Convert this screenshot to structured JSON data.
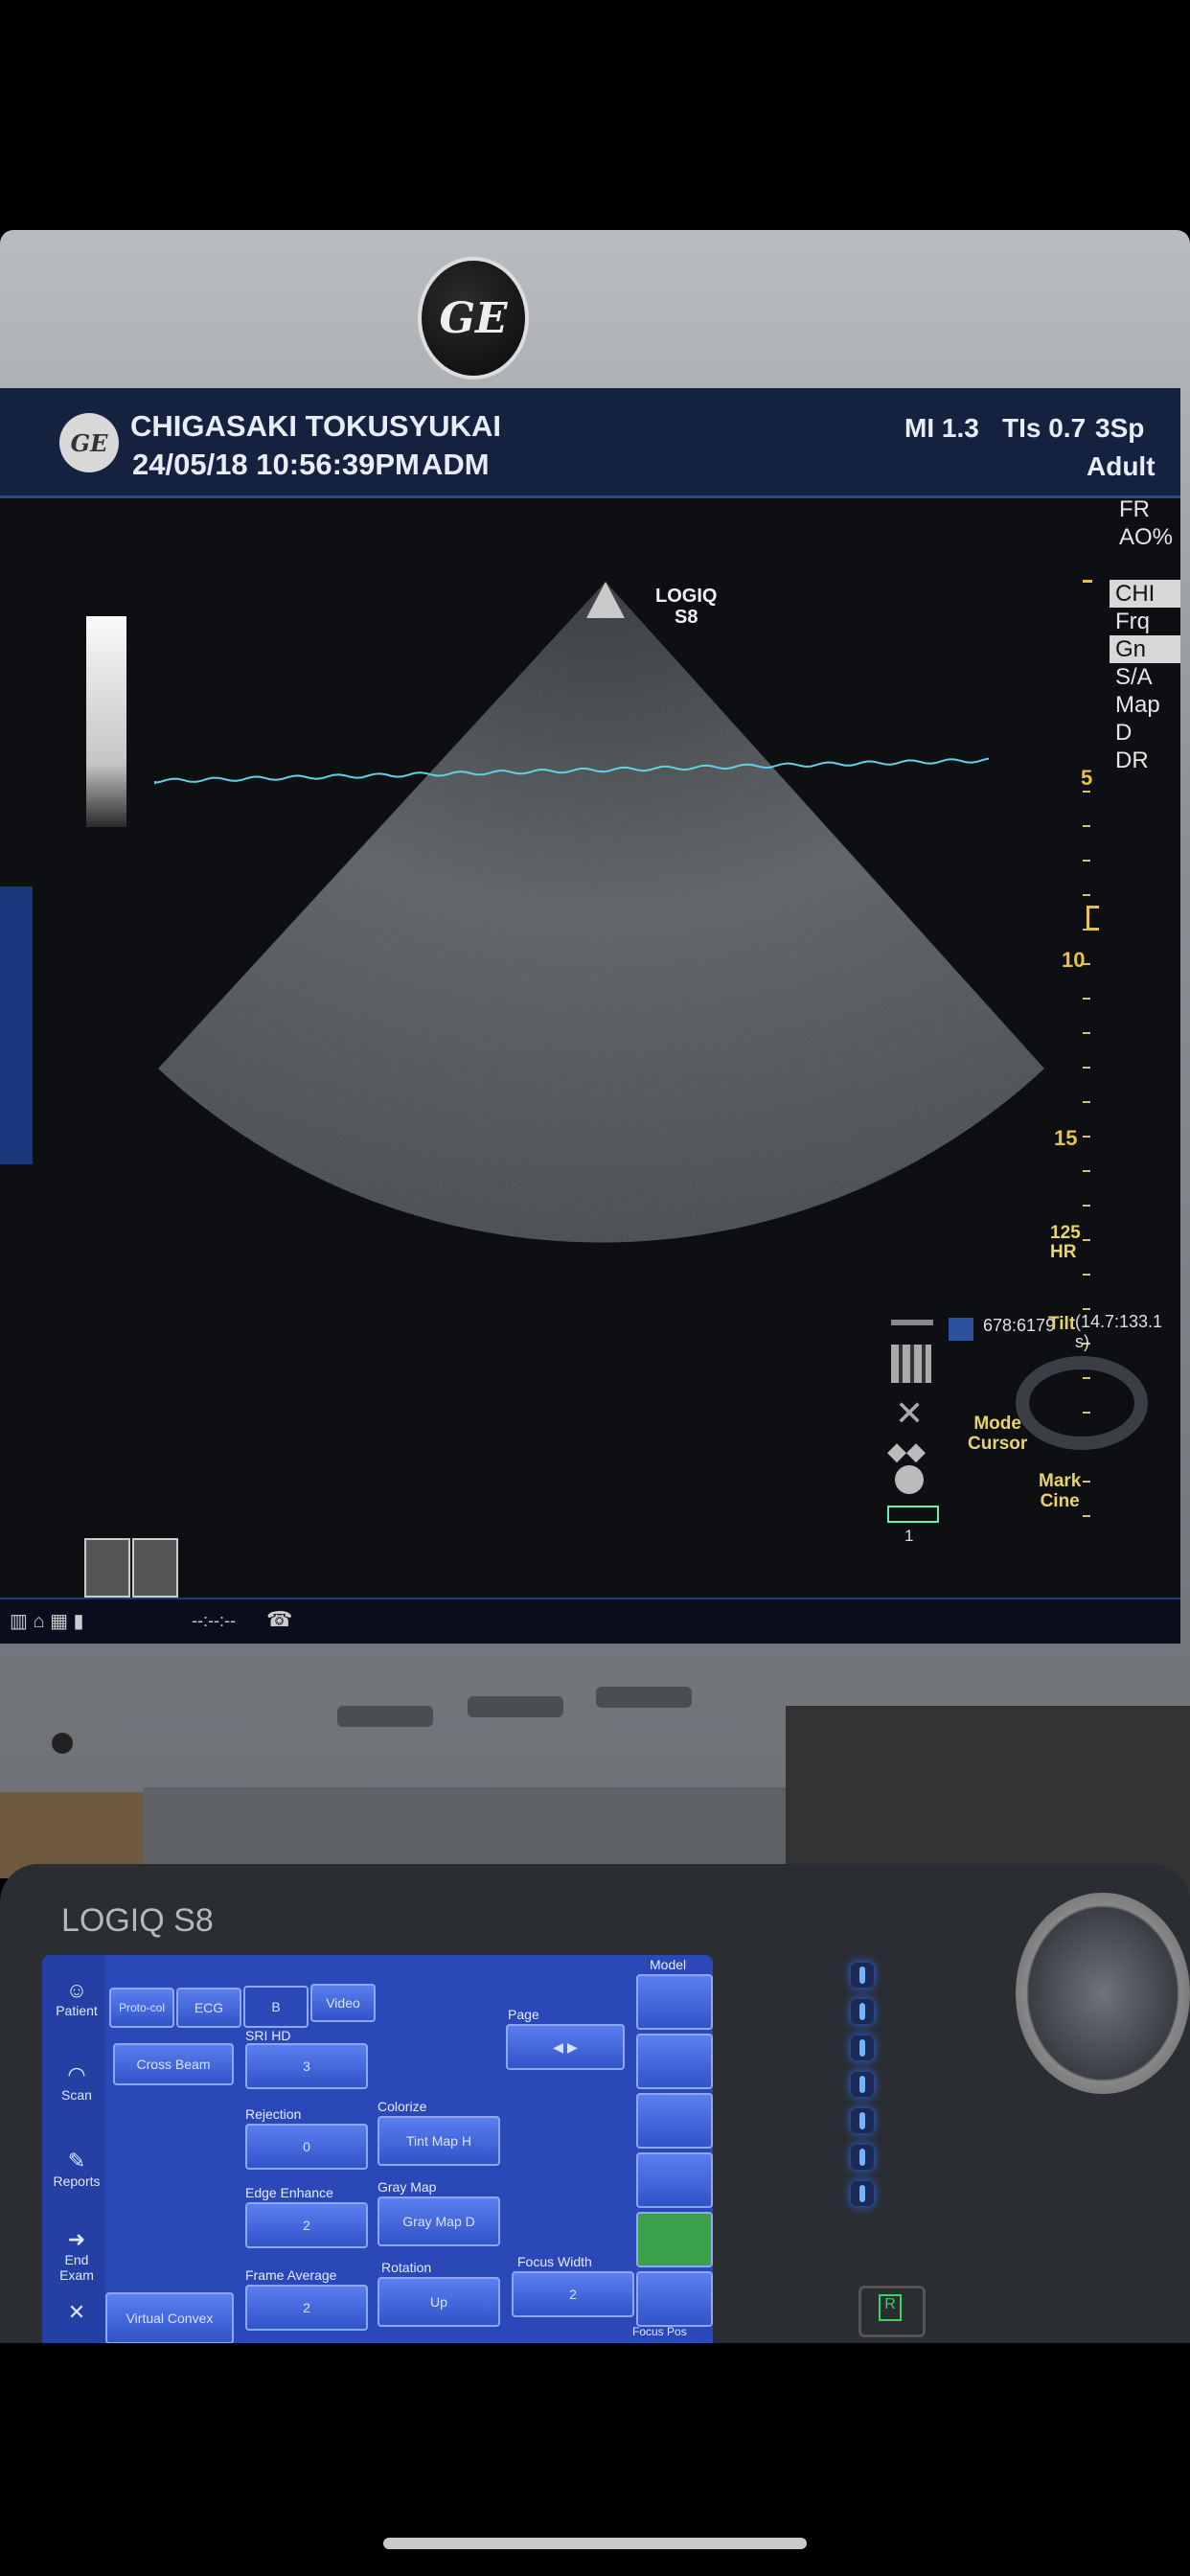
{
  "header": {
    "institution": "CHIGASAKI TOKUSYUKAI",
    "datetime": "24/05/18 10:56:39PM",
    "user": "ADM",
    "mi": "MI 1.3",
    "tis": "TIs 0.7",
    "preset_short": "3Sp",
    "patient_type": "Adult"
  },
  "image_area": {
    "probe_label_line1": "LOGIQ",
    "probe_label_line2": "S8",
    "params": [
      "FR",
      "AO%"
    ],
    "menu": [
      {
        "label": "CHI",
        "highlight": true
      },
      {
        "label": "Frq",
        "highlight": false
      },
      {
        "label": "Gn",
        "highlight": true
      },
      {
        "label": "S/A",
        "highlight": false
      },
      {
        "label": "Map",
        "highlight": false
      },
      {
        "label": "D",
        "highlight": false
      },
      {
        "label": "DR",
        "highlight": false
      }
    ],
    "depth_ticks": [
      "5",
      "10",
      "15"
    ],
    "hr_value": "125",
    "hr_label": "HR",
    "cine_counter": "678:6179",
    "cine_time": "(14.7:133.1 s)",
    "trackball": {
      "top": "Tilt",
      "left_line1": "Mode",
      "left_line2": "Cursor",
      "bottom_line1": "Mark",
      "bottom_line2": "Cine"
    },
    "page_index": "1",
    "status_time": "--:--:--",
    "ecg_color": "#5fd3e6"
  },
  "console": {
    "brand": "LOGIQ S8",
    "side_menu": [
      "Patient",
      "Scan",
      "Reports",
      "End Exam"
    ],
    "tabs": [
      "Proto-col",
      "ECG",
      "B",
      "Video"
    ],
    "model_label": "Model",
    "controls": {
      "cross_beam": "Cross Beam",
      "sri_hd_label": "SRI HD",
      "sri_hd_value": "3",
      "page_label": "Page",
      "rejection_label": "Rejection",
      "rejection_value": "0",
      "colorize_label": "Colorize",
      "colorize_value": "Tint Map H",
      "edge_label": "Edge Enhance",
      "edge_value": "2",
      "graymap_label": "Gray Map",
      "graymap_value": "Gray Map D",
      "frameavg_label": "Frame Average",
      "frameavg_value": "2",
      "rotation_label": "Rotation",
      "rotation_value": "Up",
      "focuswidth_label": "Focus Width",
      "focuswidth_value": "2",
      "virtual_convex": "Virtual Convex",
      "focus_pos": "Focus Pos"
    },
    "r_key": "R"
  }
}
